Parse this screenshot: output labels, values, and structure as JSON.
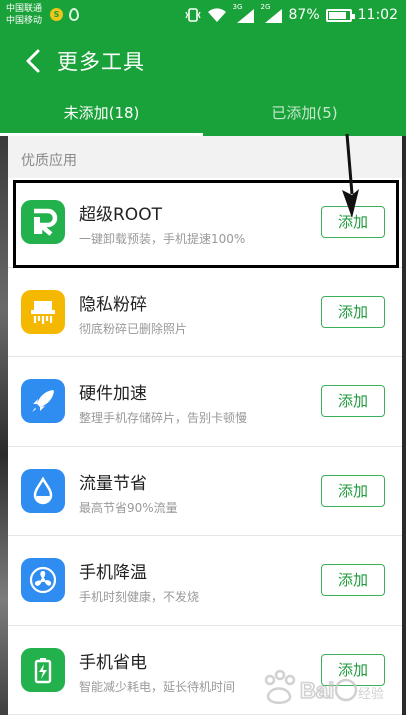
{
  "status_bar": {
    "carrier_1": "中国联通",
    "carrier_2": "中国移动",
    "network_1": "3G",
    "network_2": "2G",
    "battery_text": "87%",
    "battery_level": 0.87,
    "time": "11:02"
  },
  "app_bar": {
    "title": "更多工具"
  },
  "tabs": [
    {
      "label": "未添加(18)",
      "active": true
    },
    {
      "label": "已添加(5)",
      "active": false
    }
  ],
  "section_label": "优质应用",
  "items": [
    {
      "title": "超级ROOT",
      "desc": "一键卸载预装，手机提速100%",
      "button": "添加",
      "icon": "root-icon",
      "color": "#22b14c"
    },
    {
      "title": "隐私粉碎",
      "desc": "彻底粉碎已删除照片",
      "button": "添加",
      "icon": "shredder-icon",
      "color": "#f5b800"
    },
    {
      "title": "硬件加速",
      "desc": "整理手机存储碎片，告别卡顿慢",
      "button": "添加",
      "icon": "rocket-icon",
      "color": "#2f8cf0"
    },
    {
      "title": "流量节省",
      "desc": "最高节省90%流量",
      "button": "添加",
      "icon": "water-drop-icon",
      "color": "#2f8cf0"
    },
    {
      "title": "手机降温",
      "desc": "手机时刻健康，不发烧",
      "button": "添加",
      "icon": "fan-icon",
      "color": "#2f8cf0"
    },
    {
      "title": "手机省电",
      "desc": "智能减少耗电，延长待机时间",
      "button": "添加",
      "icon": "battery-icon",
      "color": "#22b14c"
    }
  ],
  "colors": {
    "brand": "#1aa23a",
    "button_border": "#3bb05a"
  }
}
